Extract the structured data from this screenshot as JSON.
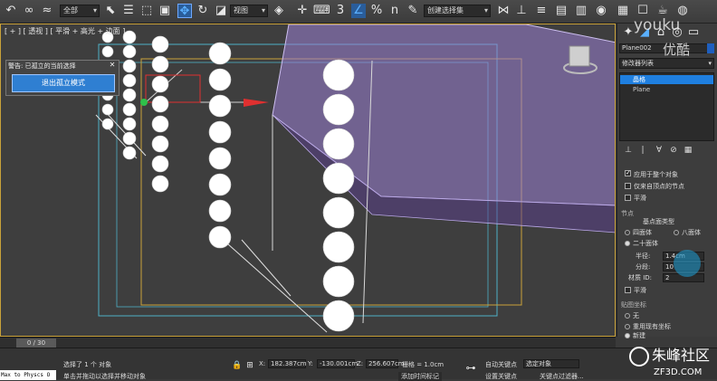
{
  "toolbar": {
    "filter_label": "全部",
    "view_label": "视图",
    "selection_set_label": "创建选择集",
    "snap_number": "3",
    "angle_number": "n"
  },
  "viewport": {
    "label": "[ + ] [ 透视 ] [ 平滑 + 高光 + 边面 ]"
  },
  "alert": {
    "title": "警告: 已孤立的当前选择",
    "button_label": "退出孤立模式"
  },
  "panel": {
    "object_name": "Plane002",
    "modifier_list": "修改器列表",
    "stack": [
      "晶格",
      "Plane"
    ],
    "options": {
      "apply_all": "应用于整个对象",
      "joints_only": "仅来自顶点的节点",
      "smooth": "平滑"
    },
    "section_joints": "节点",
    "geodesic_label": "基点面类型",
    "radio_tetra": "四面体",
    "radio_octa": "八面体",
    "radio_icosa": "二十面体",
    "radius_label": "半径:",
    "radius_value": "1.4cm",
    "segments_label": "分段:",
    "segments_value": "10",
    "material_label": "材质 ID:",
    "material_value": "2",
    "smooth_label": "平滑",
    "mapping_label": "贴图坐标",
    "map_none": "无",
    "map_reuse": "重用现有坐标",
    "map_new": "新建"
  },
  "timeline": {
    "frame": "0 / 30"
  },
  "status": {
    "selected": "选择了 1 个 对象",
    "hint": "单击并拖动以选择并移动对象",
    "x_label": "X:",
    "x_value": "182.387cm",
    "y_label": "Y:",
    "y_value": "-130.001cm",
    "z_label": "Z:",
    "z_value": "256.607cm",
    "grid": "栅格 = 1.0cm",
    "add_time_tag": "添加时间标记",
    "auto_key": "自动关键点",
    "set_key": "设置关键点",
    "selected_obj": "选定对象",
    "key_filter": "关键点过滤器...",
    "maxscript": "Max to Physcs O"
  },
  "watermark": {
    "top1": "youku",
    "top2": "优酷",
    "brand": "朱峰社区",
    "site": "ZF3D.COM"
  },
  "colors": {
    "accent": "#2f7fd2",
    "viewport_border": "#c9a23a",
    "selection": "#1f7fe0"
  }
}
